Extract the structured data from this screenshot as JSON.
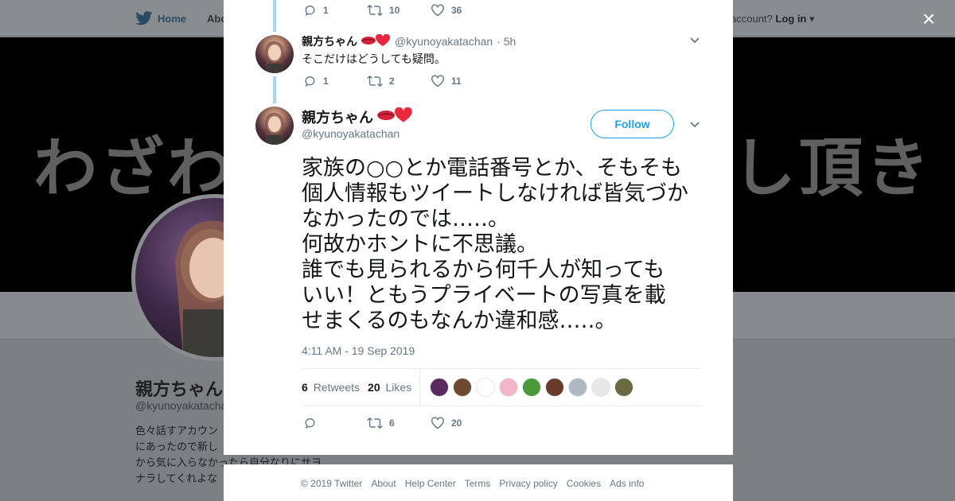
{
  "background": {
    "nav": {
      "home": "Home",
      "about": "Abo",
      "account_prompt": "account?",
      "login": "Log in"
    },
    "banner_left": "わざわ",
    "banner_right": "し頂き",
    "profile_name": "親方ちゃん",
    "profile_handle": "@kyunoyakatacha",
    "bio_lines": [
      "色々話すアカウン",
      "にあったので新し",
      "から気に入らなかったら自分なりにサヨ",
      "ナラしてくれよな"
    ]
  },
  "modal": {
    "close_label": "×",
    "prev_actions": {
      "replies": "1",
      "retweets": "10",
      "likes": "36"
    },
    "reply": {
      "name": "親方ちゃん",
      "handle": "@kyunoyakatachan",
      "time": "· 5h",
      "text": "そこだけはどうしても疑問。",
      "replies": "1",
      "retweets": "2",
      "likes": "11"
    },
    "main": {
      "name": "親方ちゃん",
      "handle": "@kyunoyakatachan",
      "follow_label": "Follow",
      "text_lines": [
        "家族の○○とか電話番号とか、そもそも",
        "個人情報もツイートしなければ皆気づか",
        "なかったのでは…‥。",
        "何故かホントに不思議。",
        "誰でも見られるから何千人が知っても",
        "いい！ともうプライベートの写真を載",
        "せまくるのもなんか違和感…‥。"
      ],
      "timestamp": "4:11 AM - 19 Sep 2019",
      "retweet_count": "6",
      "retweet_label": "Retweets",
      "like_count": "20",
      "like_label": "Likes",
      "liker_colors": [
        "#5a2a5e",
        "#6b4a2f",
        "#ffffff",
        "#f2b6c8",
        "#4a9a3a",
        "#6a3a2a",
        "#b0b8c4",
        "#e8e8e8",
        "#6a6a40"
      ],
      "actions": {
        "replies": "",
        "retweets": "6",
        "likes": "20"
      }
    }
  },
  "footer": {
    "links": [
      "© 2019 Twitter",
      "About",
      "Help Center",
      "Terms",
      "Privacy policy",
      "Cookies",
      "Ads info"
    ]
  },
  "colors": {
    "twitter_blue": "#1da1f2",
    "thread_line": "#a5d8f5",
    "muted": "#657786"
  }
}
